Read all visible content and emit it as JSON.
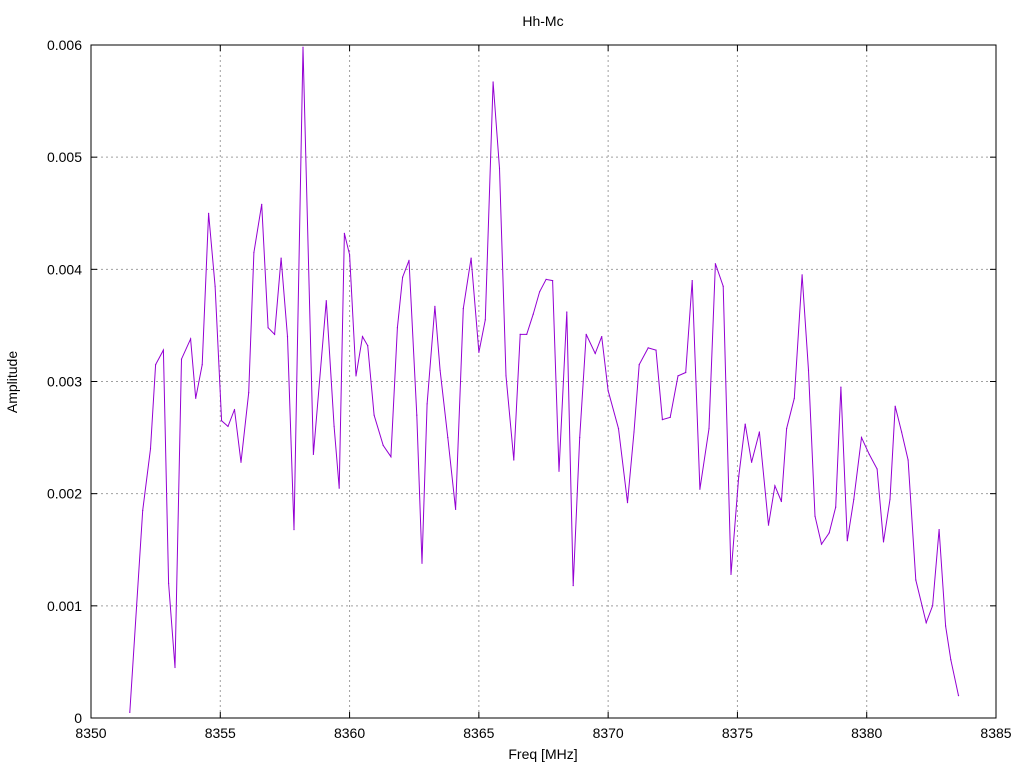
{
  "chart_data": {
    "type": "line",
    "title": "Hh-Mc",
    "xlabel": "Freq [MHz]",
    "ylabel": "Amplitude",
    "xlim": [
      8350,
      8385
    ],
    "ylim": [
      0,
      0.006
    ],
    "xticks": [
      8350,
      8355,
      8360,
      8365,
      8370,
      8375,
      8380,
      8385
    ],
    "xtick_labels": [
      "8350",
      "8355",
      "8360",
      "8365",
      "8370",
      "8375",
      "8380",
      "8385"
    ],
    "yticks": [
      0,
      0.001,
      0.002,
      0.003,
      0.004,
      0.005,
      0.006
    ],
    "ytick_labels": [
      "0",
      "0.001",
      "0.002",
      "0.003",
      "0.004",
      "0.005",
      "0.006"
    ],
    "grid": true,
    "legend": "none",
    "line_color": "#9400d3",
    "series": [
      {
        "x": [
          8351.5,
          8352.0,
          8352.3,
          8352.5,
          8352.8,
          8353.0,
          8353.25,
          8353.5,
          8353.85,
          8354.05,
          8354.3,
          8354.55,
          8354.8,
          8355.05,
          8355.3,
          8355.55,
          8355.8,
          8356.1,
          8356.3,
          8356.6,
          8356.85,
          8357.1,
          8357.35,
          8357.6,
          8357.85,
          8358.2,
          8358.6,
          8359.1,
          8359.4,
          8359.6,
          8359.8,
          8360.0,
          8360.25,
          8360.5,
          8360.7,
          8360.95,
          8361.3,
          8361.6,
          8361.85,
          8362.05,
          8362.3,
          8362.6,
          8362.8,
          8363.0,
          8363.3,
          8363.5,
          8363.8,
          8364.1,
          8364.4,
          8364.7,
          8365.0,
          8365.25,
          8365.55,
          8365.8,
          8366.05,
          8366.35,
          8366.6,
          8366.85,
          8367.1,
          8367.35,
          8367.6,
          8367.85,
          8368.1,
          8368.4,
          8368.65,
          8368.9,
          8369.15,
          8369.5,
          8369.75,
          8370.0,
          8370.4,
          8370.75,
          8371.0,
          8371.2,
          8371.55,
          8371.85,
          8372.1,
          8372.4,
          8372.7,
          8373.0,
          8373.25,
          8373.55,
          8373.9,
          8374.15,
          8374.45,
          8374.75,
          8375.05,
          8375.3,
          8375.55,
          8375.85,
          8376.2,
          8376.45,
          8376.7,
          8376.9,
          8377.2,
          8377.5,
          8377.75,
          8378.0,
          8378.25,
          8378.55,
          8378.8,
          8379.0,
          8379.25,
          8379.5,
          8379.8,
          8380.1,
          8380.4,
          8380.65,
          8380.9,
          8381.1,
          8381.35,
          8381.6,
          8381.9,
          8382.3,
          8382.55,
          8382.8,
          8383.05,
          8383.25,
          8383.55
        ],
        "y": [
          5e-05,
          0.00185,
          0.0024,
          0.00315,
          0.00328,
          0.0012,
          0.00045,
          0.0032,
          0.00338,
          0.00285,
          0.00315,
          0.0045,
          0.00385,
          0.00265,
          0.0026,
          0.00275,
          0.00228,
          0.0029,
          0.00415,
          0.00458,
          0.00348,
          0.00342,
          0.0041,
          0.0034,
          0.00168,
          0.00598,
          0.00235,
          0.00372,
          0.0026,
          0.00205,
          0.00432,
          0.00413,
          0.00305,
          0.0034,
          0.00332,
          0.0027,
          0.00243,
          0.00233,
          0.00348,
          0.00393,
          0.00408,
          0.0027,
          0.00138,
          0.0028,
          0.00367,
          0.0031,
          0.0025,
          0.00186,
          0.00365,
          0.0041,
          0.00326,
          0.00355,
          0.00567,
          0.0049,
          0.00305,
          0.0023,
          0.00342,
          0.00342,
          0.0036,
          0.0038,
          0.00391,
          0.0039,
          0.0022,
          0.00362,
          0.00118,
          0.0025,
          0.00342,
          0.00325,
          0.0034,
          0.00292,
          0.00258,
          0.00192,
          0.00255,
          0.00315,
          0.0033,
          0.00328,
          0.00266,
          0.00268,
          0.00305,
          0.00308,
          0.0039,
          0.00204,
          0.00258,
          0.00405,
          0.00385,
          0.00128,
          0.00215,
          0.00262,
          0.00228,
          0.00255,
          0.00172,
          0.00207,
          0.00193,
          0.00258,
          0.00285,
          0.00395,
          0.0031,
          0.0018,
          0.00155,
          0.00165,
          0.00188,
          0.00295,
          0.00158,
          0.00195,
          0.0025,
          0.00235,
          0.00222,
          0.00157,
          0.00195,
          0.00278,
          0.00255,
          0.0023,
          0.00123,
          0.00085,
          0.001,
          0.00168,
          0.00082,
          0.00052,
          0.0002
        ]
      }
    ]
  }
}
